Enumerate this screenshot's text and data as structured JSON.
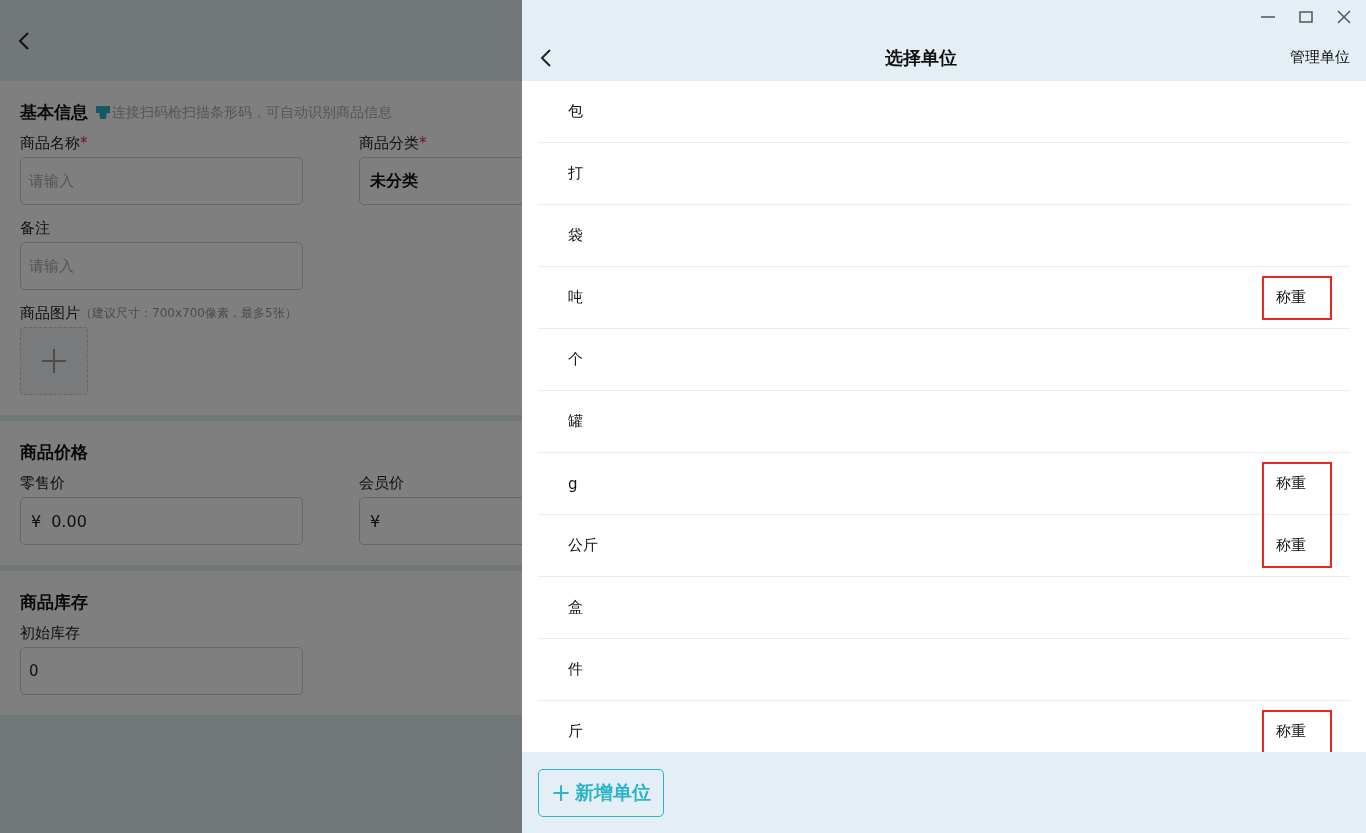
{
  "form": {
    "sections": [
      {
        "title": "基本信息",
        "hint": "连接扫码枪扫描条形码，可自动识别商品信息",
        "fields": [
          {
            "kind": "input",
            "label": "商品名称",
            "required_mark": "*",
            "placeholder": "请输入"
          },
          {
            "kind": "select",
            "label": "商品分类",
            "required_mark": "*",
            "value": "未分类"
          },
          {
            "kind": "input",
            "label": "备注",
            "placeholder": "请输入"
          },
          {
            "kind": "image",
            "label": "商品图片",
            "note": "（建议尺寸：700x700像素，最多5张）"
          }
        ]
      },
      {
        "title": "商品价格",
        "fields": [
          {
            "kind": "price",
            "label": "零售价",
            "currency": "¥",
            "value": "0.00"
          },
          {
            "kind": "price",
            "label": "会员价",
            "currency": "¥"
          }
        ]
      },
      {
        "title": "商品库存",
        "fields": [
          {
            "kind": "input",
            "label": "初始库存",
            "value": "0"
          }
        ]
      }
    ]
  },
  "panel": {
    "title": "选择单位",
    "action": "管理单位",
    "add_button": "新增单位",
    "add_icon": "+",
    "units": [
      {
        "name": "包"
      },
      {
        "name": "打"
      },
      {
        "name": "袋"
      },
      {
        "name": "吨",
        "tag": "称重",
        "boxed": true
      },
      {
        "name": "个"
      },
      {
        "name": "罐"
      },
      {
        "name": "g",
        "tag": "称重",
        "boxed": true
      },
      {
        "name": "公斤",
        "tag": "称重",
        "boxed": true
      },
      {
        "name": "盒"
      },
      {
        "name": "件"
      },
      {
        "name": "斤",
        "tag": "称重",
        "boxed": true
      }
    ]
  }
}
